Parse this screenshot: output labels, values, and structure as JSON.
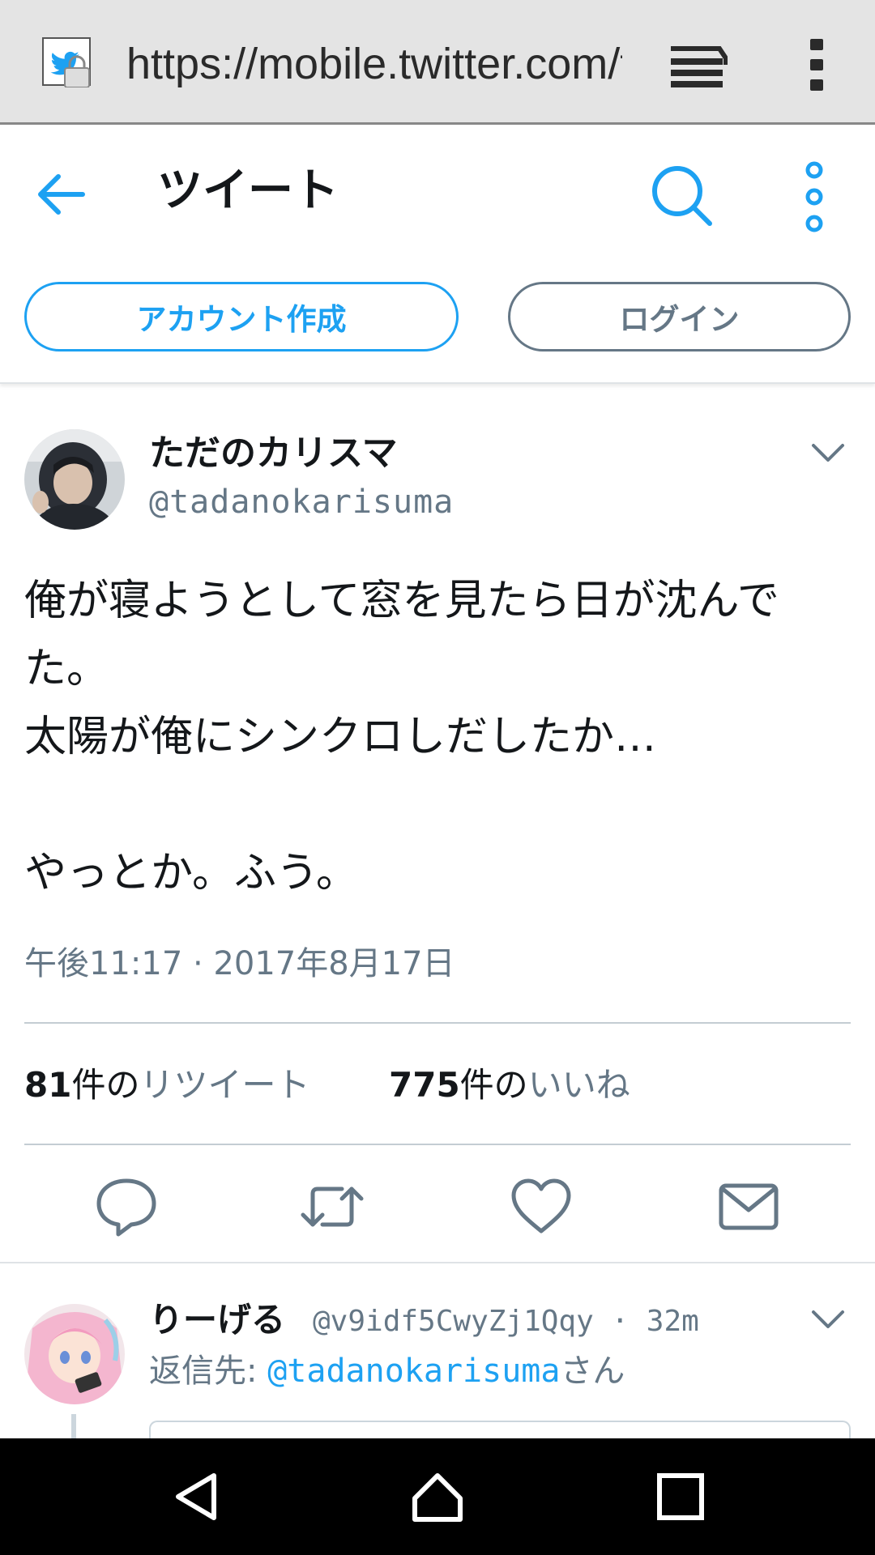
{
  "browser": {
    "url": "https://mobile.twitter.com/tadanokarisuma/status",
    "favicon": "twitter-bird-icon",
    "lock": "lock-icon"
  },
  "header": {
    "title": "ツイート",
    "signup_label": "アカウント作成",
    "login_label": "ログイン"
  },
  "tweet": {
    "display_name": "ただのカリスマ",
    "handle": "@tadanokarisuma",
    "text": "俺が寝ようとして窓を見たら日が沈んでた。\n太陽が俺にシンクロしだしたか…\n\nやっとか。ふう。",
    "timestamp": "午後11:17 · 2017年8月17日",
    "retweets": {
      "count": "81",
      "unit": "件の",
      "label": "リツイート"
    },
    "likes": {
      "count": "775",
      "unit": "件の",
      "label": "いいね"
    },
    "actions": [
      "reply-icon",
      "retweet-icon",
      "like-icon",
      "message-icon"
    ]
  },
  "reply": {
    "display_name": "りーげる",
    "meta": "@v9idf5CwyZj1Qqy · 32m",
    "reply_prefix": "返信先: ",
    "mention": "@tadanokarisuma",
    "suffix": "さん"
  },
  "colors": {
    "accent": "#1da1f2",
    "secondary_text": "#657786",
    "chrome_bg": "#e4e4e4",
    "nav_bg": "#000000"
  },
  "nav": [
    "back-triangle-icon",
    "home-circle-icon",
    "recents-square-icon"
  ]
}
